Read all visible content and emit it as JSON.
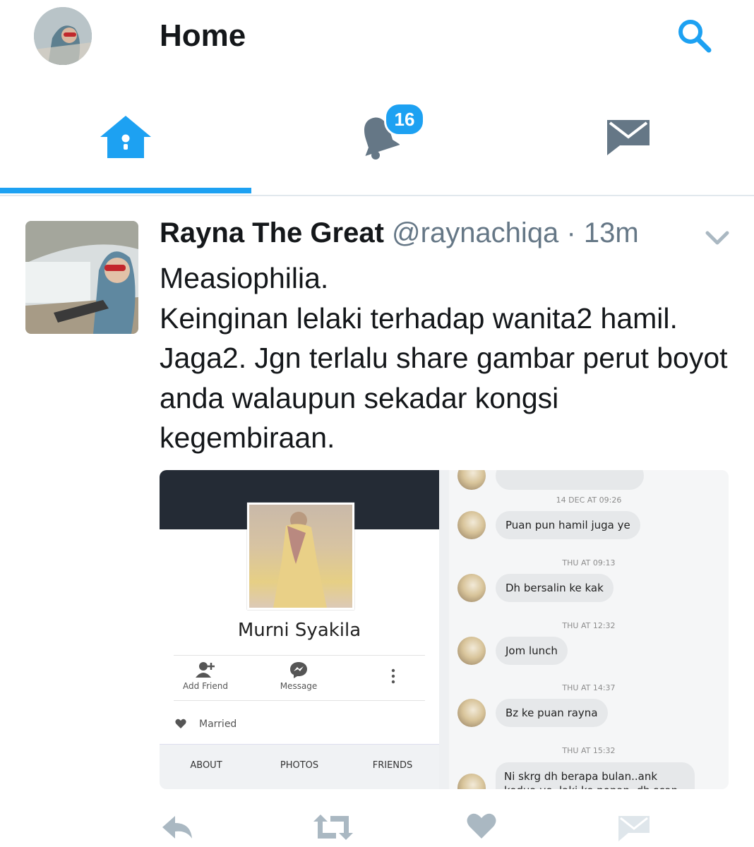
{
  "header": {
    "title": "Home"
  },
  "tabs": [
    {
      "name": "home",
      "active": true
    },
    {
      "name": "notifications",
      "badge": "16"
    },
    {
      "name": "messages"
    }
  ],
  "tweet": {
    "author_name": "Rayna The Great",
    "handle": "@raynachiqa",
    "separator": "·",
    "time": "13m",
    "text_lines": [
      "Measiophilia.",
      "Keinginan lelaki terhadap wanita2 hamil.",
      "Jaga2. Jgn terlalu share gambar perut boyot",
      "anda walaupun sekadar kongsi",
      "kegembiraan."
    ]
  },
  "media_left": {
    "profile_name": "Murni Syakila",
    "actions": [
      "Add Friend",
      "Message"
    ],
    "married": "Married",
    "tabs": [
      "ABOUT",
      "PHOTOS",
      "FRIENDS"
    ]
  },
  "media_right": {
    "messages": [
      {
        "time": "14 DEC AT 09:26",
        "text": "Puan pun hamil juga ye"
      },
      {
        "time": "THU AT 09:13",
        "text": "Dh bersalin ke kak"
      },
      {
        "time": "THU AT 12:32",
        "text": "Jom lunch"
      },
      {
        "time": "THU AT 14:37",
        "text": "Bz ke puan rayna"
      },
      {
        "time": "THU AT 15:32",
        "text": "Ni skrg dh berapa bulan..ank kedua ye..laki ke ponan..dh scan ke"
      }
    ]
  },
  "colors": {
    "accent": "#1da1f2",
    "icon_gray": "#657786",
    "action_gray": "#aab8c2"
  },
  "icons": [
    "search-icon",
    "home-icon",
    "bell-icon",
    "envelope-icon",
    "chevron-down-icon",
    "reply-icon",
    "retweet-icon",
    "heart-icon",
    "direct-message-icon"
  ]
}
